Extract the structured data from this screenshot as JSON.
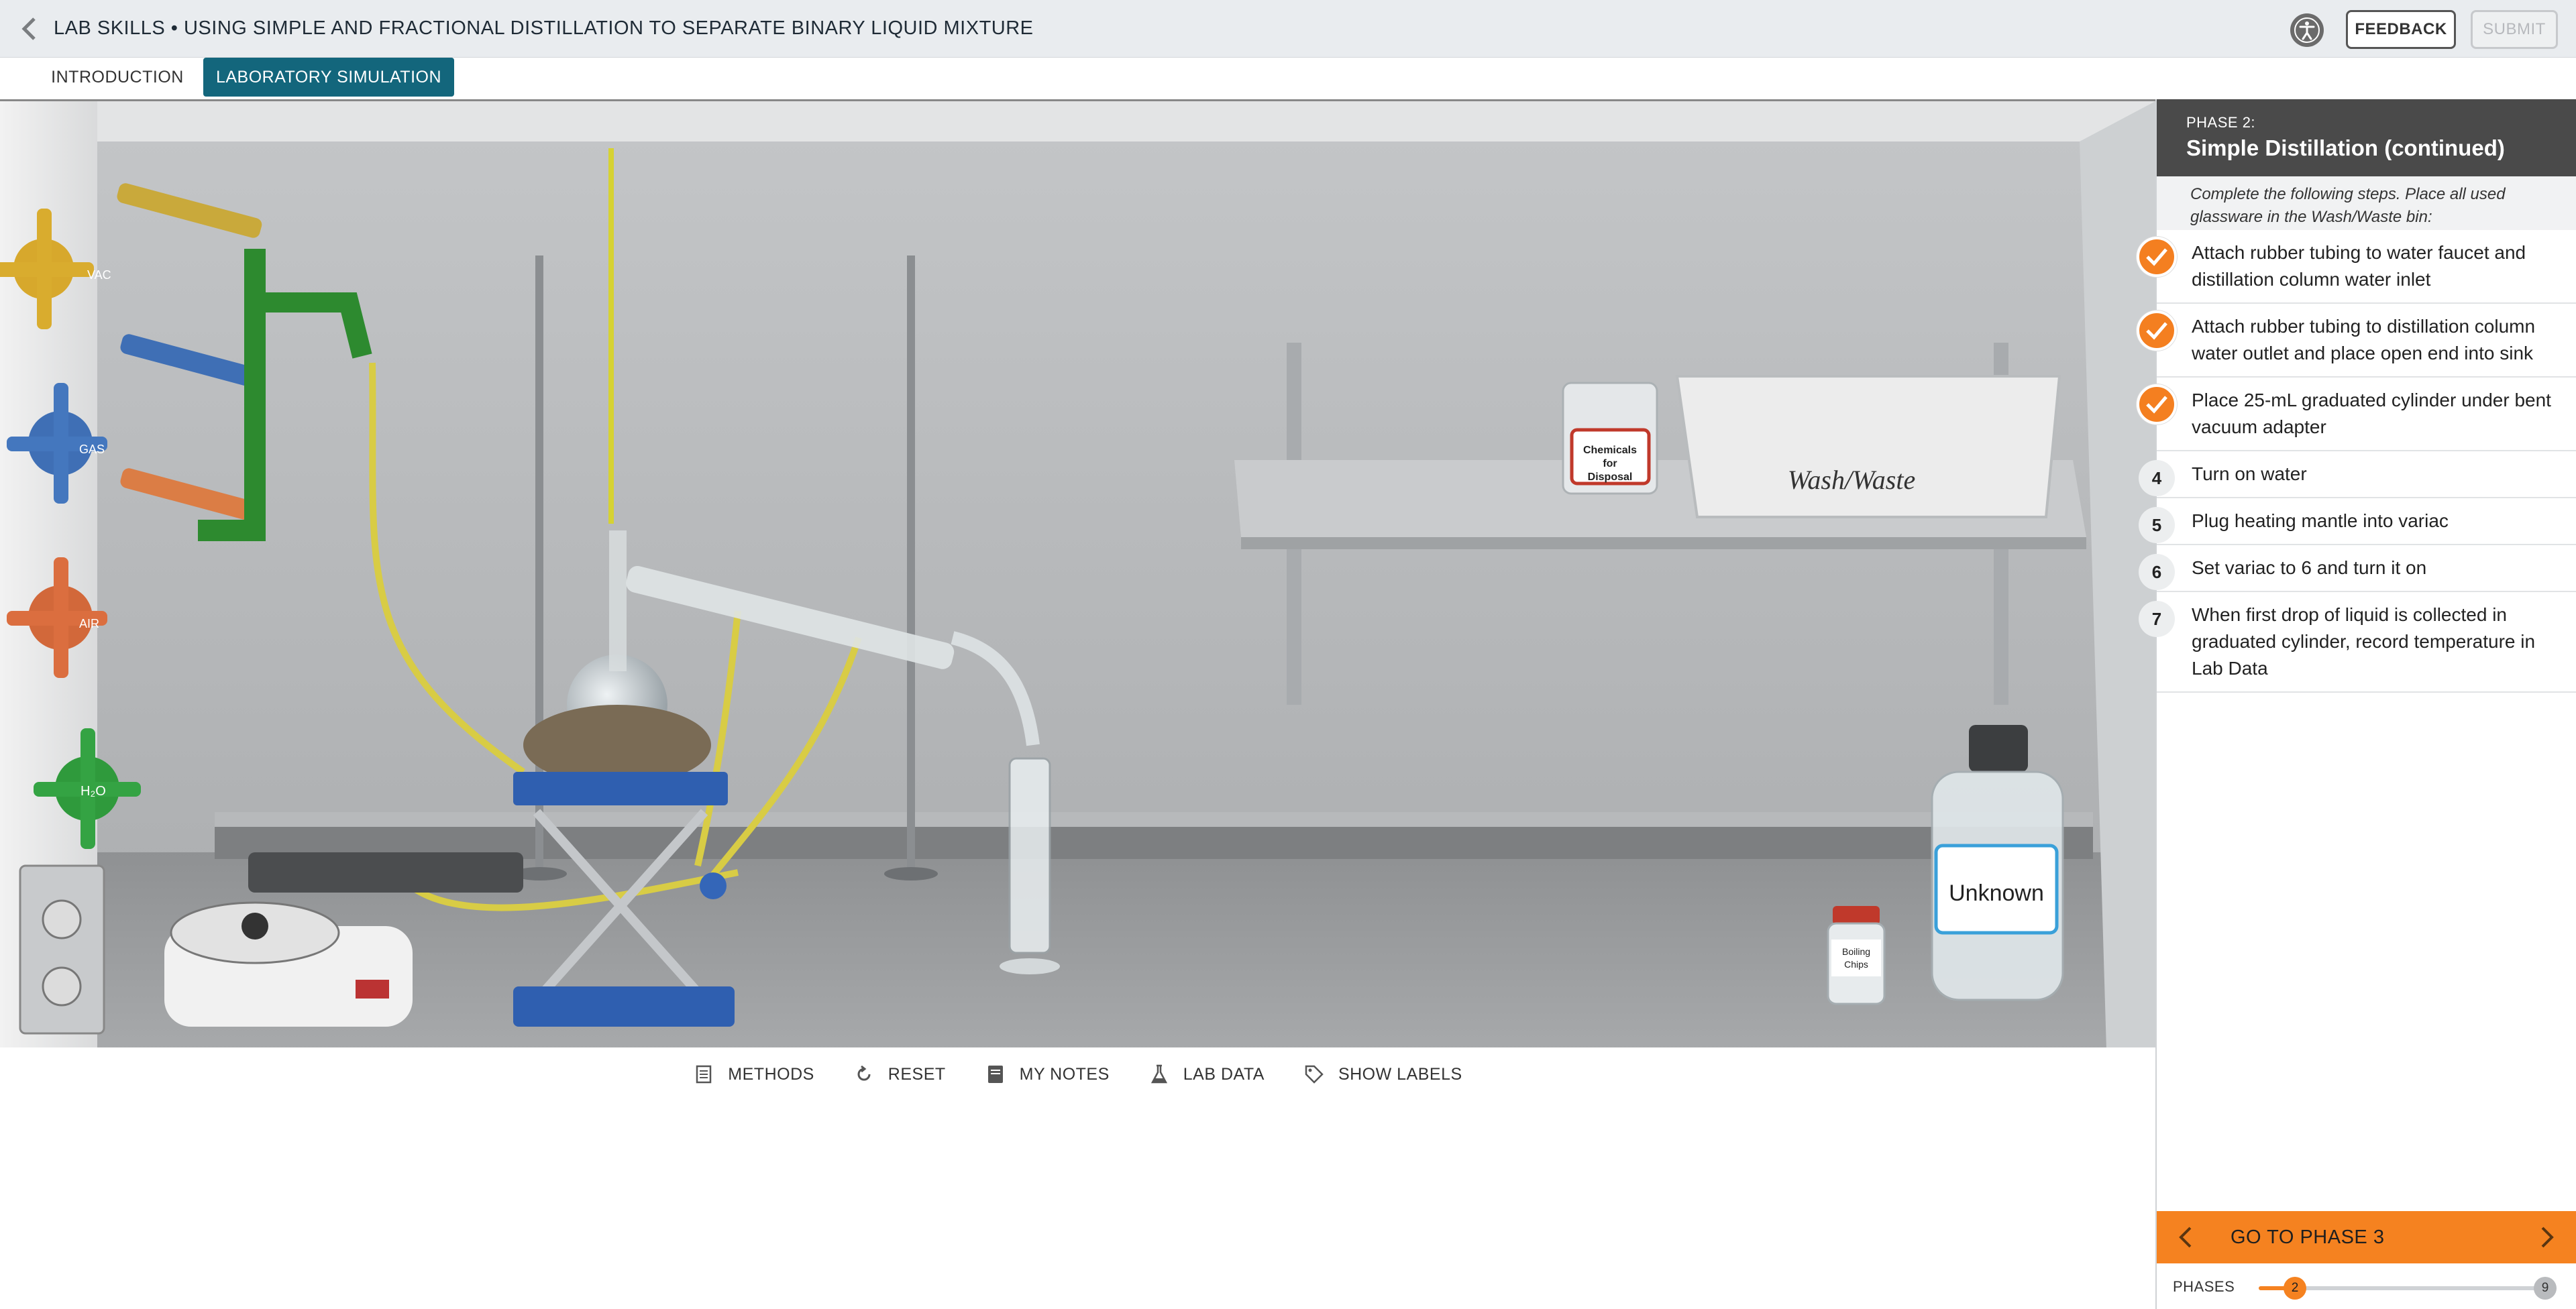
{
  "header": {
    "title": "LAB SKILLS • USING SIMPLE AND FRACTIONAL DISTILLATION TO SEPARATE BINARY LIQUID MIXTURE",
    "feedback_label": "FEEDBACK",
    "submit_label": "SUBMIT"
  },
  "tabs": [
    {
      "label": "INTRODUCTION",
      "active": false
    },
    {
      "label": "LABORATORY SIMULATION",
      "active": true
    }
  ],
  "scene": {
    "valve_labels": [
      "VAC",
      "GAS",
      "AIR",
      "H₂O"
    ],
    "beaker_label": "Chemicals for Disposal",
    "bin_label": "Wash/Waste",
    "bottle_label": "Unknown",
    "chips_label": "Boiling Chips"
  },
  "toolbar": {
    "methods": "METHODS",
    "reset": "RESET",
    "notes": "MY NOTES",
    "lab_data": "LAB DATA",
    "show_labels": "SHOW LABELS"
  },
  "panel": {
    "phase_label": "PHASE 2:",
    "phase_title": "Simple Distillation (continued)",
    "instructions": "Complete the following steps. Place all used glassware in the Wash/Waste bin:",
    "steps": [
      {
        "num": "1",
        "done": true,
        "text": "Attach rubber tubing to water faucet and distillation column water inlet"
      },
      {
        "num": "2",
        "done": true,
        "text": "Attach rubber tubing to distillation column water outlet and place open end into sink"
      },
      {
        "num": "3",
        "done": true,
        "text": "Place 25-mL graduated cylinder under bent vacuum adapter"
      },
      {
        "num": "4",
        "done": false,
        "text": "Turn on water"
      },
      {
        "num": "5",
        "done": false,
        "text": "Plug heating mantle into variac"
      },
      {
        "num": "6",
        "done": false,
        "text": "Set variac to 6 and turn it on"
      },
      {
        "num": "7",
        "done": false,
        "text": "When first drop of liquid is collected in graduated cylinder, record temperature in Lab Data"
      }
    ],
    "goto_label": "GO TO PHASE 3",
    "phases_label": "PHASES",
    "current_phase": "2",
    "total_phases": "9",
    "phase_progress": 0.125
  },
  "colors": {
    "accent": "#f58220",
    "tab_active": "#13667c",
    "phase_header": "#4a4a4a"
  }
}
